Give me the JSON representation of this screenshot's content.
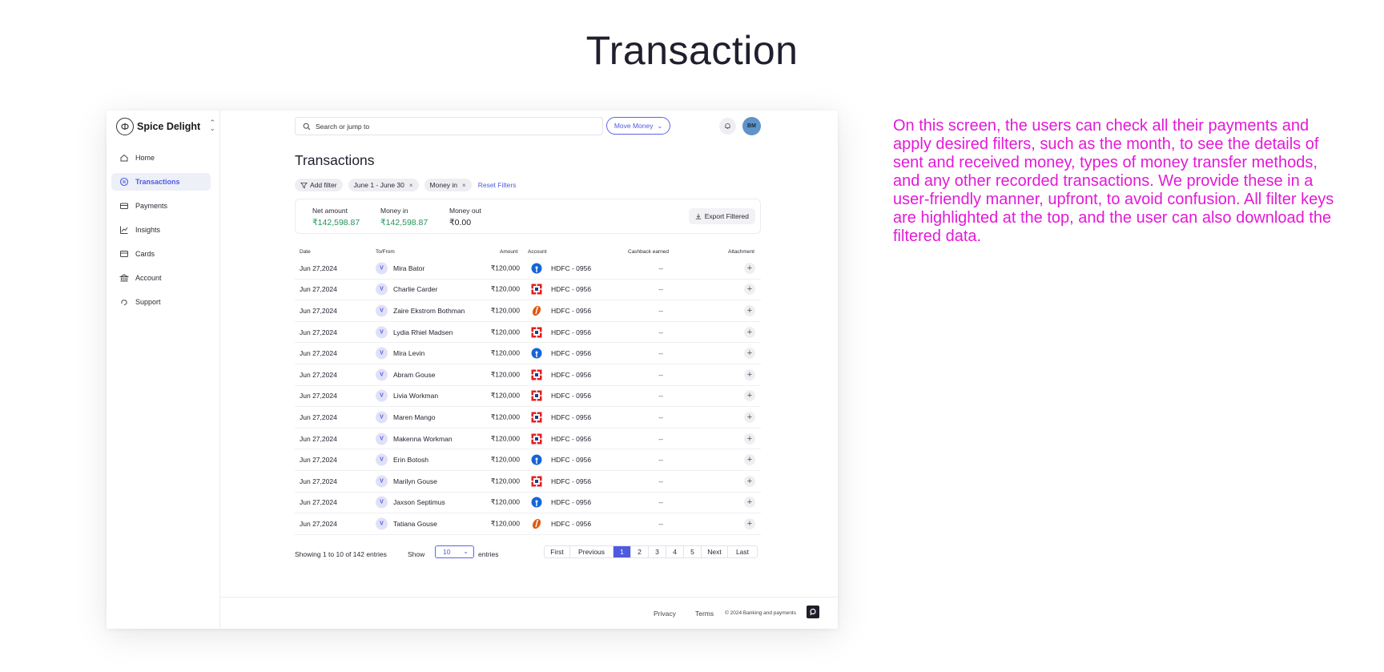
{
  "page": {
    "title": "Transaction",
    "description": "On this screen, the users can check all their payments and apply desired filters, such as the month, to see the details of sent and received money, types of money transfer methods, and any other recorded transactions. We provide these in a user-friendly manner, upfront, to avoid confusion. All filter keys are highlighted at the top, and the user can also download the filtered data."
  },
  "sidebar": {
    "brand": "Spice Delight",
    "items": [
      {
        "label": "Home",
        "icon": "home-icon"
      },
      {
        "label": "Transactions",
        "icon": "transactions-icon",
        "active": true
      },
      {
        "label": "Payments",
        "icon": "payments-icon"
      },
      {
        "label": "Insights",
        "icon": "insights-icon"
      },
      {
        "label": "Cards",
        "icon": "cards-icon"
      },
      {
        "label": "Account",
        "icon": "bank-icon"
      },
      {
        "label": "Support",
        "icon": "support-icon"
      }
    ]
  },
  "topbar": {
    "search_placeholder": "Search or jump to",
    "move_money": "Move Money",
    "avatar_initials": "BM"
  },
  "main": {
    "heading": "Transactions",
    "filters": {
      "add": "Add filter",
      "chips": [
        "June 1 - June 30",
        "Money in"
      ],
      "reset": "Reset Filters"
    },
    "summary": {
      "net_label": "Net amount",
      "net_value": "₹142,598.87",
      "in_label": "Money in",
      "in_value": "₹142,598.87",
      "out_label": "Money out",
      "out_value": "₹0.00",
      "export": "Export Filtered"
    },
    "table": {
      "columns": [
        "Date",
        "To/From",
        "Amount",
        "Account",
        "Cashback earned",
        "Attachment"
      ],
      "rows": [
        {
          "date": "Jun 27,2024",
          "initial": "V",
          "name": "Mira Bator",
          "amount": "₹120,000",
          "bank": "sbi",
          "account": "HDFC - 0956",
          "cashback": "--"
        },
        {
          "date": "Jun 27,2024",
          "initial": "V",
          "name": "Charlie Carder",
          "amount": "₹120,000",
          "bank": "hdfc",
          "account": "HDFC - 0956",
          "cashback": "--"
        },
        {
          "date": "Jun 27,2024",
          "initial": "V",
          "name": "Zaire Ekstrom Bothman",
          "amount": "₹120,000",
          "bank": "icici",
          "account": "HDFC - 0956",
          "cashback": "--"
        },
        {
          "date": "Jun 27,2024",
          "initial": "V",
          "name": "Lydia Rhiel Madsen",
          "amount": "₹120,000",
          "bank": "hdfc",
          "account": "HDFC - 0956",
          "cashback": "--"
        },
        {
          "date": "Jun 27,2024",
          "initial": "V",
          "name": "Mira Levin",
          "amount": "₹120,000",
          "bank": "sbi",
          "account": "HDFC - 0956",
          "cashback": "--"
        },
        {
          "date": "Jun 27,2024",
          "initial": "V",
          "name": "Abram Gouse",
          "amount": "₹120,000",
          "bank": "hdfc",
          "account": "HDFC - 0956",
          "cashback": "--"
        },
        {
          "date": "Jun 27,2024",
          "initial": "V",
          "name": "Livia Workman",
          "amount": "₹120,000",
          "bank": "hdfc",
          "account": "HDFC - 0956",
          "cashback": "--"
        },
        {
          "date": "Jun 27,2024",
          "initial": "V",
          "name": "Maren Mango",
          "amount": "₹120,000",
          "bank": "hdfc",
          "account": "HDFC - 0956",
          "cashback": "--"
        },
        {
          "date": "Jun 27,2024",
          "initial": "V",
          "name": "Makenna Workman",
          "amount": "₹120,000",
          "bank": "hdfc",
          "account": "HDFC - 0956",
          "cashback": "--"
        },
        {
          "date": "Jun 27,2024",
          "initial": "V",
          "name": "Erin Botosh",
          "amount": "₹120,000",
          "bank": "sbi",
          "account": "HDFC - 0956",
          "cashback": "--"
        },
        {
          "date": "Jun 27,2024",
          "initial": "V",
          "name": "Marilyn Gouse",
          "amount": "₹120,000",
          "bank": "hdfc",
          "account": "HDFC - 0956",
          "cashback": "--"
        },
        {
          "date": "Jun 27,2024",
          "initial": "V",
          "name": "Jaxson Septimus",
          "amount": "₹120,000",
          "bank": "sbi",
          "account": "HDFC - 0956",
          "cashback": "--"
        },
        {
          "date": "Jun 27,2024",
          "initial": "V",
          "name": "Tatiana Gouse",
          "amount": "₹120,000",
          "bank": "icici",
          "account": "HDFC - 0956",
          "cashback": "--"
        }
      ]
    },
    "pager": {
      "info": "Showing 1 to 10 of 142 entries",
      "show": "Show",
      "per_page": "10",
      "entries": "entries",
      "buttons": [
        "First",
        "Previous",
        "1",
        "2",
        "3",
        "4",
        "5",
        "Next",
        "Last"
      ],
      "active": "1"
    }
  },
  "footer": {
    "privacy": "Privacy",
    "terms": "Terms",
    "copyright": "© 2024 Banking and payments"
  },
  "colors": {
    "accent": "#4f5ae0",
    "positive": "#23945a",
    "annotation": "#e31ad6",
    "sbi": "#1565d8",
    "hdfc": "#e02020",
    "icici": "#e05a10"
  }
}
